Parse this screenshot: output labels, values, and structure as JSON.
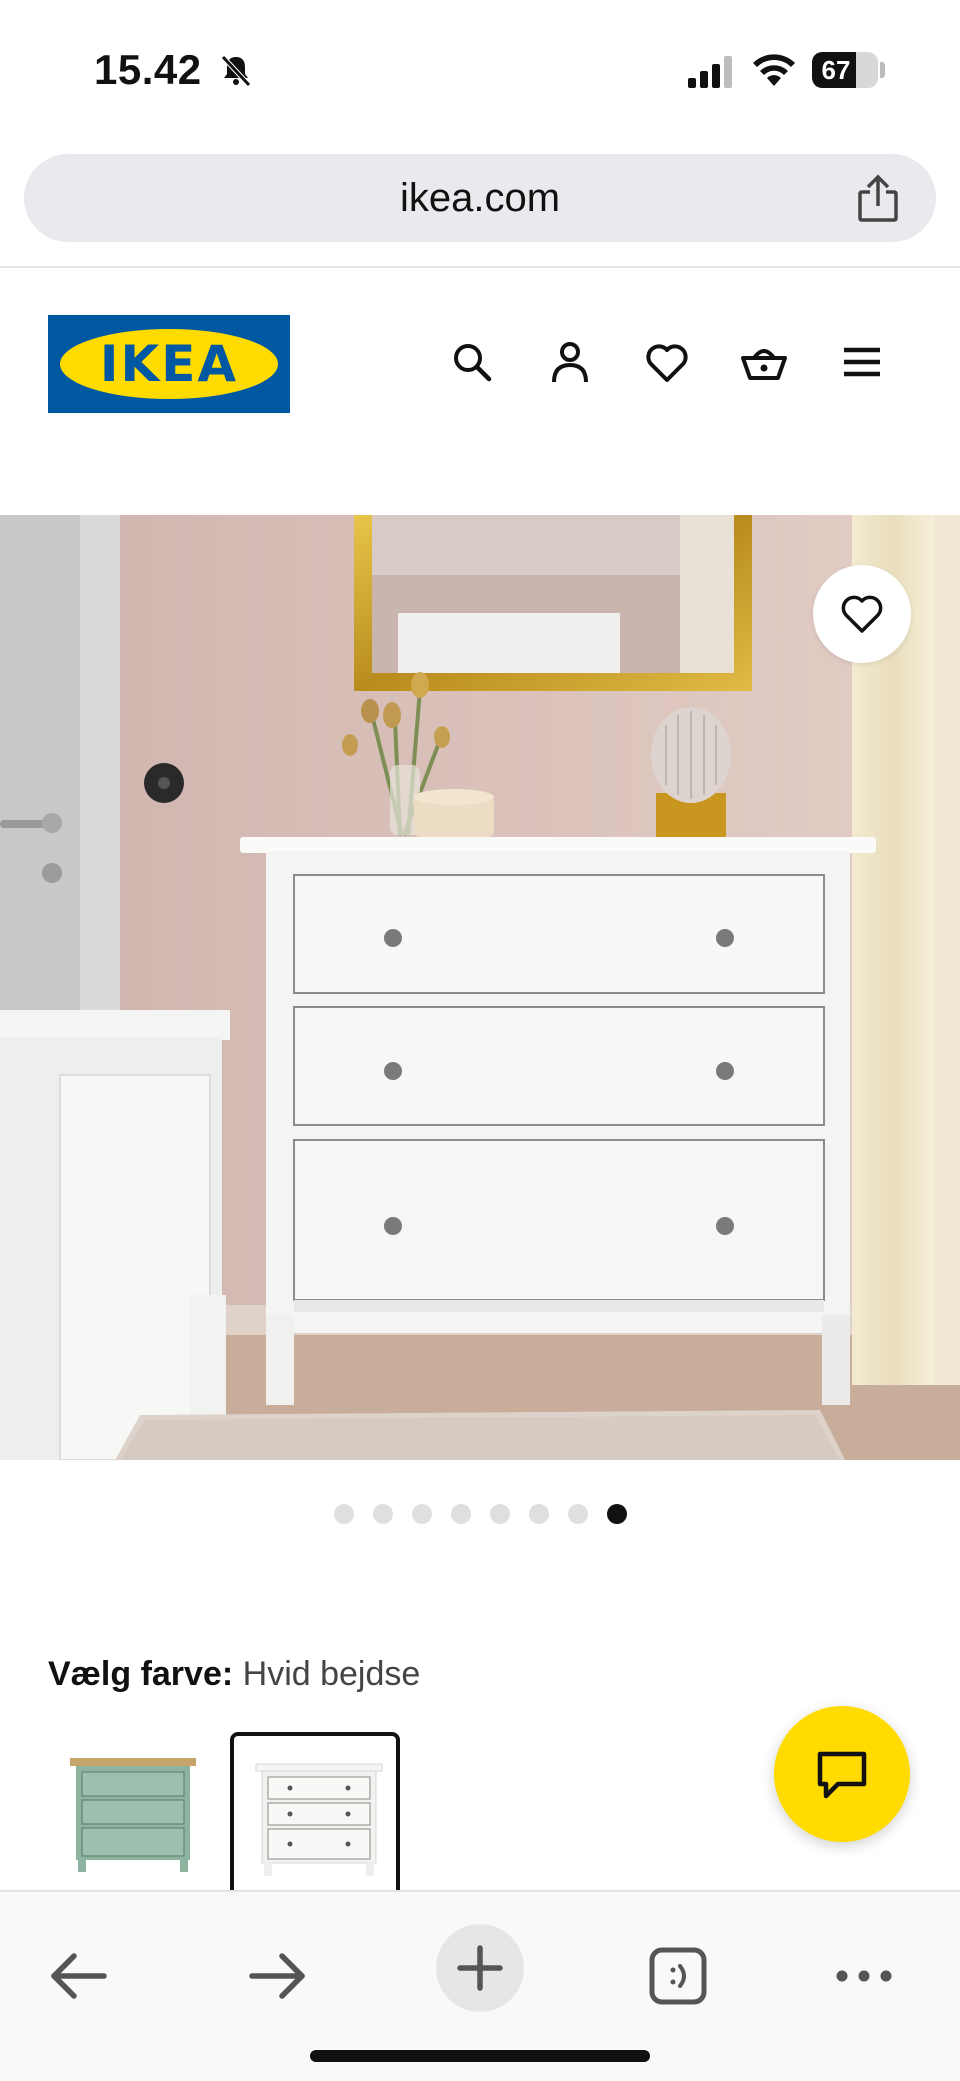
{
  "status_bar": {
    "time": "15.42",
    "battery_level": "67",
    "battery_fraction": 0.67
  },
  "browser": {
    "url": "ikea.com"
  },
  "header": {
    "logo_text": "IKEA",
    "icons": [
      "search-icon",
      "account-icon",
      "heart-icon",
      "basket-icon",
      "menu-icon"
    ]
  },
  "gallery": {
    "image_count": 8,
    "active_index": 7,
    "image_subject": "White HEMNES-style 3-drawer chest in a pink room with a gold mirror"
  },
  "color_selector": {
    "label": "Vælg farve:",
    "selected_value": "Hvid bejdse",
    "swatches": [
      {
        "color": "#8fb3a1",
        "selected": false
      },
      {
        "color": "#f2f2f0",
        "selected": true
      }
    ]
  },
  "colors": {
    "ikea_blue": "#0058a3",
    "ikea_yellow": "#ffdb00",
    "wall_pink": "#d7bfb8",
    "mirror_gold": "#c9a227"
  },
  "toolbar": {
    "icons": [
      "back-arrow-icon",
      "forward-arrow-icon",
      "new-tab-plus-icon",
      "tabs-icon",
      "more-icon"
    ]
  }
}
